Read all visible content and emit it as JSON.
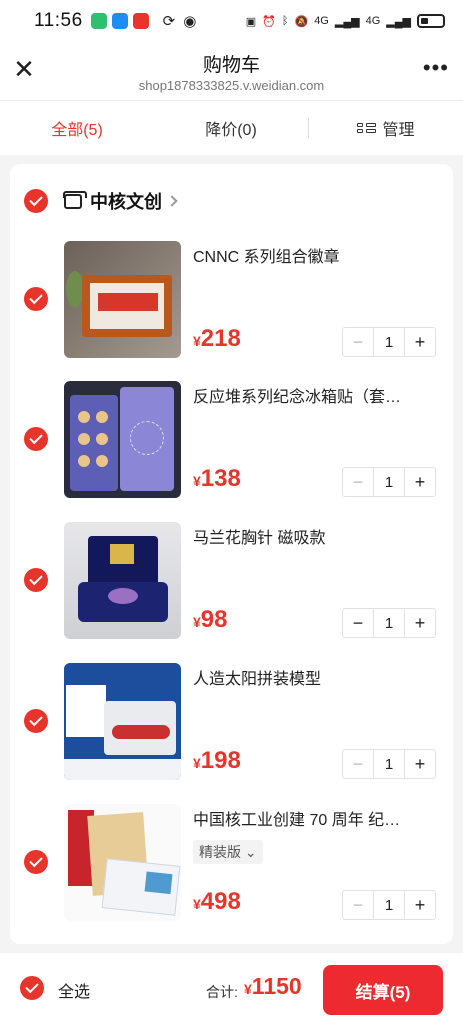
{
  "status_bar": {
    "time": "11:56",
    "network_1": "4G",
    "network_2": "4G"
  },
  "title_bar": {
    "title": "购物车",
    "url": "shop1878333825.v.weidian.com"
  },
  "tabs": [
    {
      "label": "全部(5)",
      "active": true
    },
    {
      "label": "降价(0)",
      "active": false
    },
    {
      "label": "管理",
      "active": false
    }
  ],
  "store": {
    "name": "中核文创"
  },
  "items": [
    {
      "title": "CNNC 系列组合徽章",
      "variant": "",
      "currency": "¥",
      "price": "218",
      "qty": "1"
    },
    {
      "title": "反应堆系列纪念冰箱贴（套…",
      "variant": "",
      "currency": "¥",
      "price": "138",
      "qty": "1"
    },
    {
      "title": "马兰花胸针 磁吸款",
      "variant": "",
      "currency": "¥",
      "price": "98",
      "qty": "1"
    },
    {
      "title": "人造太阳拼装模型",
      "variant": "",
      "currency": "¥",
      "price": "198",
      "qty": "1"
    },
    {
      "title": "中国核工业创建 70 周年 纪…",
      "variant": "精装版",
      "currency": "¥",
      "price": "498",
      "qty": "1"
    }
  ],
  "bottom_bar": {
    "select_all": "全选",
    "total_label": "合计:",
    "total_currency": "¥",
    "total_value": "1150",
    "checkout_label": "结算(5)"
  },
  "colors": {
    "accent": "#e8352b",
    "checkout": "#ed2a2f"
  }
}
